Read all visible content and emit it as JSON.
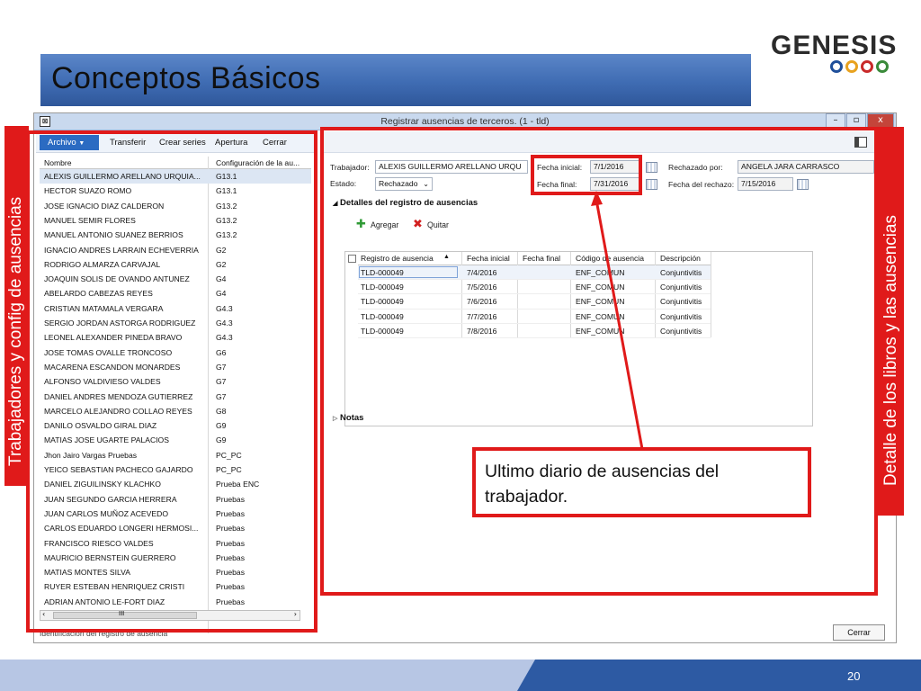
{
  "slide": {
    "title": "Conceptos Básicos",
    "page_number": "20",
    "logo_text": "GENESIS",
    "logo_ring_colors": [
      "#1f4f9a",
      "#e8a21f",
      "#c92a2a",
      "#3a8a3a"
    ]
  },
  "window": {
    "title": "Registrar ausencias de terceros. (1 - tld)",
    "controls": [
      "–",
      "▫",
      "x"
    ],
    "status_text": "Identificación del registro de ausencia",
    "close_label": "Cerrar"
  },
  "left_toolbar": {
    "archivo": "Archivo",
    "items": [
      "Transferir",
      "Crear series",
      "Apertura",
      "Cerrar"
    ]
  },
  "workers_grid": {
    "headers": [
      "Nombre",
      "Configuración de la au..."
    ],
    "rows": [
      [
        "ALEXIS GUILLERMO ARELLANO URQUIA...",
        "G13.1"
      ],
      [
        "HECTOR SUAZO  ROMO",
        "G13.1"
      ],
      [
        "JOSE IGNACIO DIAZ CALDERON",
        "G13.2"
      ],
      [
        "MANUEL SEMIR FLORES",
        "G13.2"
      ],
      [
        "MANUEL ANTONIO SUANEZ  BERRIOS",
        "G13.2"
      ],
      [
        "IGNACIO ANDRES LARRAIN  ECHEVERRIA",
        "G2"
      ],
      [
        "RODRIGO ALMARZA CARVAJAL",
        "G2"
      ],
      [
        "JOAQUIN SOLIS DE OVANDO  ANTUNEZ",
        "G4"
      ],
      [
        "ABELARDO CABEZAS REYES",
        "G4"
      ],
      [
        "CRISTIAN MATAMALA VERGARA",
        "G4.3"
      ],
      [
        "SERGIO JORDAN ASTORGA  RODRIGUEZ",
        "G4.3"
      ],
      [
        "LEONEL ALEXANDER PINEDA  BRAVO",
        "G4.3"
      ],
      [
        "JOSE TOMAS OVALLE TRONCOSO",
        "G6"
      ],
      [
        "MACARENA ESCANDON MONARDES",
        "G7"
      ],
      [
        "ALFONSO VALDIVIESO VALDES",
        "G7"
      ],
      [
        "DANIEL ANDRES MENDOZA GUTIERREZ",
        "G7"
      ],
      [
        "MARCELO ALEJANDRO COLLAO REYES",
        "G8"
      ],
      [
        "DANILO OSVALDO GIRAL DIAZ",
        "G9"
      ],
      [
        "MATIAS JOSE UGARTE  PALACIOS",
        "G9"
      ],
      [
        "Jhon Jairo Vargas Pruebas",
        "PC_PC"
      ],
      [
        "YEICO SEBASTIAN PACHECO GAJARDO",
        "PC_PC"
      ],
      [
        "DANIEL ZIGUILINSKY KLACHKO",
        "Prueba ENC"
      ],
      [
        "JUAN SEGUNDO GARCIA HERRERA",
        "Pruebas"
      ],
      [
        "JUAN CARLOS MUÑOZ ACEVEDO",
        "Pruebas"
      ],
      [
        "CARLOS EDUARDO LONGERI HERMOSI...",
        "Pruebas"
      ],
      [
        "FRANCISCO RIESCO VALDES",
        "Pruebas"
      ],
      [
        "MAURICIO BERNSTEIN GUERRERO",
        "Pruebas"
      ],
      [
        "MATIAS MONTES SILVA",
        "Pruebas"
      ],
      [
        "RUYER ESTEBAN HENRIQUEZ CRISTI",
        "Pruebas"
      ],
      [
        "ADRIAN ANTONIO LE-FORT DIAZ",
        "Pruebas"
      ]
    ],
    "scroll_thumb_label": "III"
  },
  "header_form": {
    "trabajador_label": "Trabajador:",
    "trabajador_value": "ALEXIS GUILLERMO ARELLANO URQU",
    "estado_label": "Estado:",
    "estado_value": "Rechazado",
    "fecha_inicial_label": "Fecha inicial:",
    "fecha_inicial_value": "7/1/2016",
    "fecha_final_label": "Fecha final:",
    "fecha_final_value": "7/31/2016",
    "rechazado_por_label": "Rechazado por:",
    "rechazado_por_value": "ANGELA JARA CARRASCO",
    "fecha_rechazo_label": "Fecha del rechazo:",
    "fecha_rechazo_value": "7/15/2016"
  },
  "details": {
    "section_title": "Detalles del registro de ausencias",
    "add_label": "Agregar",
    "remove_label": "Quitar",
    "headers": [
      "Registro de ausencia",
      "Fecha inicial",
      "Fecha final",
      "Código de ausencia",
      "Descripción"
    ],
    "rows": [
      [
        "TLD-000049",
        "7/4/2016",
        "",
        "ENF_COMUN",
        "Conjuntivitis"
      ],
      [
        "TLD-000049",
        "7/5/2016",
        "",
        "ENF_COMUN",
        "Conjuntivitis"
      ],
      [
        "TLD-000049",
        "7/6/2016",
        "",
        "ENF_COMUN",
        "Conjuntivitis"
      ],
      [
        "TLD-000049",
        "7/7/2016",
        "",
        "ENF_COMUN",
        "Conjuntivitis"
      ],
      [
        "TLD-000049",
        "7/8/2016",
        "",
        "ENF_COMUN",
        "Conjuntivitis"
      ]
    ],
    "notas_label": "Notas"
  },
  "annotations": {
    "left_vertical": "Trabajadores y config de ausencias",
    "right_vertical": "Detalle de los libros y las ausencias",
    "callout": "Ultimo diario de ausencias del trabajador.",
    "accent_color": "#e01a1a"
  }
}
